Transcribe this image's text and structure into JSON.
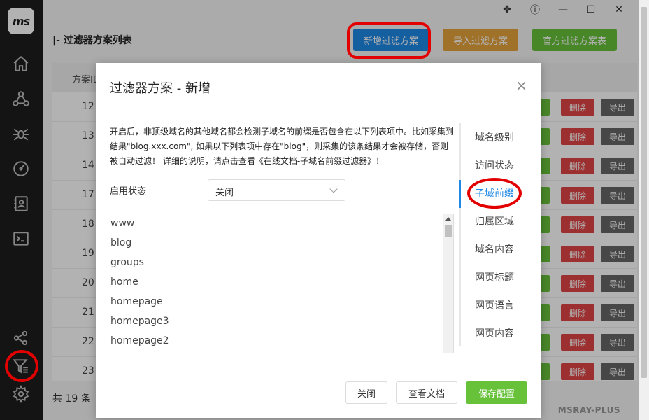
{
  "app": {
    "logo_text": "ms",
    "brand": "MSRAY-PLUS"
  },
  "sidebar": {
    "items": [
      {
        "icon": "home-icon"
      },
      {
        "icon": "cluster-icon"
      },
      {
        "icon": "spider-icon"
      },
      {
        "icon": "gauge-icon"
      },
      {
        "icon": "contacts-icon"
      },
      {
        "icon": "terminal-icon"
      },
      {
        "icon": "share-icon"
      },
      {
        "icon": "filter-icon"
      },
      {
        "icon": "gear-icon"
      }
    ]
  },
  "titlebar": {
    "icons": [
      "move-icon",
      "help-icon",
      "minimize-icon",
      "maximize-icon",
      "close-icon"
    ]
  },
  "page": {
    "title": "|- 过滤器方案列表",
    "buttons": {
      "add": "新增过滤方案",
      "import": "导入过滤方案",
      "official": "官方过滤方案表"
    },
    "colors": {
      "add": "#1e88e5",
      "import": "#e6a23c",
      "official": "#67c23a",
      "delete": "#e04545",
      "export": "#666666",
      "edit": "#67c23a"
    },
    "table": {
      "header": "方案ID",
      "rows": [
        {
          "id": "12",
          "delete": "删除",
          "export": "导出"
        },
        {
          "id": "13",
          "delete": "删除",
          "export": "导出"
        },
        {
          "id": "14",
          "delete": "删除",
          "export": "导出"
        },
        {
          "id": "17",
          "delete": "删除",
          "export": "导出"
        },
        {
          "id": "18",
          "delete": "删除",
          "export": "导出"
        },
        {
          "id": "19",
          "delete": "删除",
          "export": "导出"
        },
        {
          "id": "20",
          "delete": "删除",
          "export": "导出"
        },
        {
          "id": "21",
          "delete": "删除",
          "export": "导出"
        },
        {
          "id": "22",
          "delete": "删除",
          "export": "导出"
        },
        {
          "id": "23",
          "delete": "删除",
          "export": "导出"
        }
      ]
    },
    "total": "共 19 条"
  },
  "dialog": {
    "title": "过滤器方案 - 新增",
    "description": "开启后，非顶级域名的其他域名都会检测子域名的前缀是否包含在以下列表项中。比如采集到结果\"blog.xxx.com\", 如果以下列表项中存在\"blog\"，则采集的该条结果才会被存储，否则被自动过滤！ 详细的说明，请点击查看《在线文档-子域名前缀过滤器》！",
    "enable_label": "启用状态",
    "enable_value": "关闭",
    "prefixes": [
      "www",
      "blog",
      "groups",
      "home",
      "homepage",
      "homepage3",
      "homepage2"
    ],
    "tabs": [
      "域名级别",
      "访问状态",
      "子域前缀",
      "归属区域",
      "域名内容",
      "网页标题",
      "网页语言",
      "网页内容"
    ],
    "active_tab": "子域前缀",
    "buttons": {
      "close": "关闭",
      "docs": "查看文档",
      "save": "保存配置"
    }
  }
}
